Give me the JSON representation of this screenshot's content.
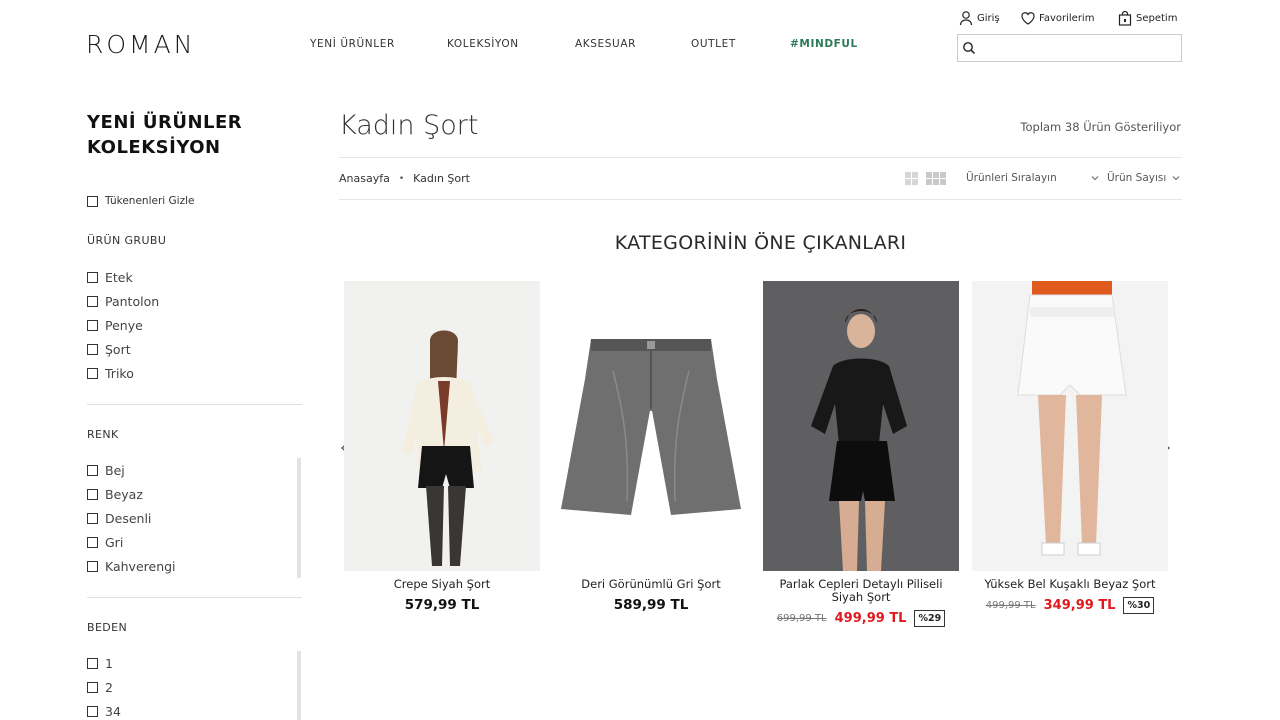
{
  "header": {
    "logo": "ROMAN",
    "nav": [
      "YENİ ÜRÜNLER",
      "KOLEKSİYON",
      "AKSESUAR",
      "OUTLET",
      "#MINDFUL"
    ],
    "user_links": {
      "login": "Giriş",
      "favorites": "Favorilerim",
      "cart": "Sepetim"
    },
    "search_placeholder": ""
  },
  "sidebar": {
    "title_line1": "YENİ ÜRÜNLER",
    "title_line2": "KOLEKSİYON",
    "hide_out_of_stock": "Tükenenleri Gizle",
    "groups": [
      {
        "title": "ÜRÜN GRUBU",
        "items": [
          "Etek",
          "Pantolon",
          "Penye",
          "Şort",
          "Triko"
        ]
      },
      {
        "title": "RENK",
        "items": [
          "Bej",
          "Beyaz",
          "Desenli",
          "Gri",
          "Kahverengi"
        ]
      },
      {
        "title": "BEDEN",
        "items": [
          "1",
          "2",
          "34"
        ]
      }
    ]
  },
  "main": {
    "title": "Kadın Şort",
    "total": "Toplam 38 Ürün Gösteriliyor",
    "breadcrumb": [
      "Anasayfa",
      "Kadın Şort"
    ],
    "sort_label": "Ürünleri Sıralayın",
    "count_label": "Ürün Sayısı",
    "section_title": "KATEGORİNİN ÖNE ÇIKANLARI",
    "products": [
      {
        "name": "Crepe Siyah Şort",
        "price": "579,99 TL"
      },
      {
        "name": "Deri Görünümlü Gri Şort",
        "price": "589,99 TL"
      },
      {
        "name": "Parlak Cepleri Detaylı Piliseli Siyah Şort",
        "old_price": "699,99 TL",
        "sale_price": "499,99 TL",
        "discount": "%29"
      },
      {
        "name": "Yüksek Bel Kuşaklı Beyaz Şort",
        "old_price": "499,99 TL",
        "sale_price": "349,99 TL",
        "discount": "%30"
      }
    ]
  },
  "icons": {
    "user": "user-icon",
    "heart": "heart-icon",
    "bag": "shopping-bag-icon",
    "search": "search-icon",
    "prev": "chevron-left-icon",
    "next": "chevron-right-icon"
  },
  "colors": {
    "accent_mindful": "#2d7a5a",
    "sale_red": "#e0191f"
  }
}
